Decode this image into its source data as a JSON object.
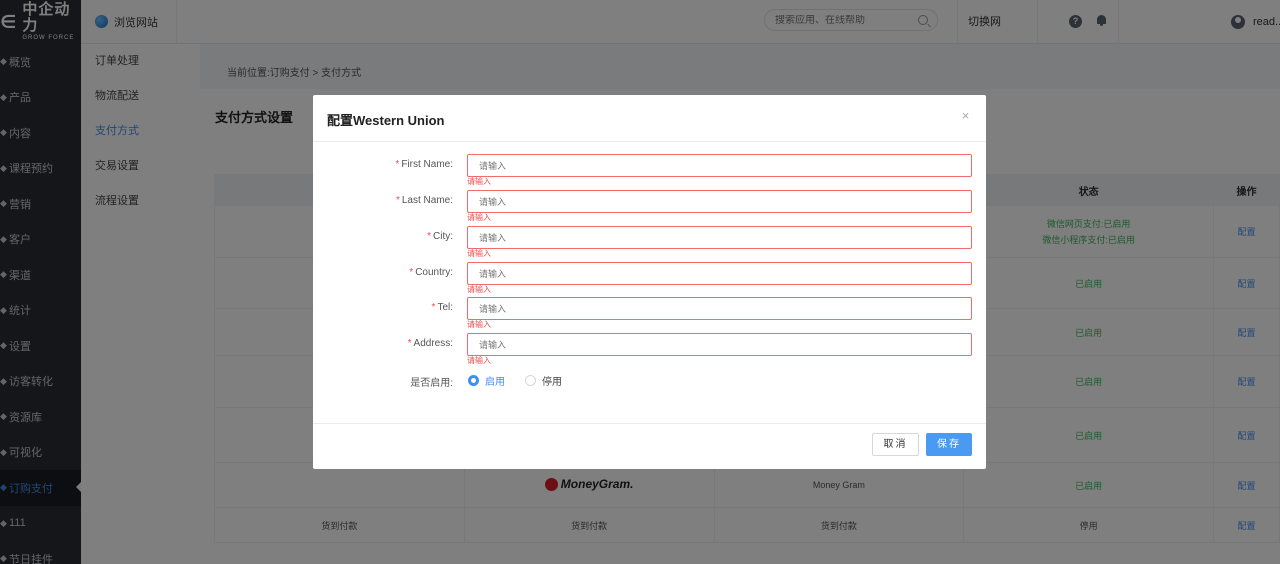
{
  "brand": {
    "logo_cn": "中企动力",
    "logo_en": "GROW FORCE"
  },
  "topbar": {
    "site_link": "浏览网站",
    "search_placeholder": "搜索应用、在线帮助",
    "switch_site": "切换网站",
    "user_name": "read..."
  },
  "sidebar": {
    "items": [
      {
        "label": "概览"
      },
      {
        "label": "产品"
      },
      {
        "label": "内容"
      },
      {
        "label": "课程预约"
      },
      {
        "label": "营销"
      },
      {
        "label": "客户"
      },
      {
        "label": "渠道"
      },
      {
        "label": "统计"
      },
      {
        "label": "设置"
      },
      {
        "label": "访客转化"
      },
      {
        "label": "资源库"
      },
      {
        "label": "可视化"
      },
      {
        "label": "订购支付"
      },
      {
        "label": "111"
      },
      {
        "label": "节日挂件"
      }
    ],
    "active_index": 12
  },
  "subnav": {
    "items": [
      {
        "label": "订单处理"
      },
      {
        "label": "物流配送"
      },
      {
        "label": "支付方式"
      },
      {
        "label": "交易设置"
      },
      {
        "label": "流程设置"
      }
    ],
    "active_index": 2
  },
  "breadcrumb": {
    "text": "当前位置:订购支付 > 支付方式"
  },
  "page": {
    "title": "支付方式设置"
  },
  "table": {
    "headers": [
      "",
      "",
      "",
      "状态",
      "操作"
    ],
    "rows": [
      {
        "c1": "",
        "c2": "",
        "c3": "",
        "status": [
          "微信网页支付:已启用",
          "微信小程序支付:已启用"
        ],
        "action": "配置"
      },
      {
        "c1": "",
        "c2": "",
        "c3": "",
        "status": [
          "已启用"
        ],
        "action": "配置"
      },
      {
        "c1": "",
        "c2": "",
        "c3": "",
        "status": [
          "已启用"
        ],
        "action": "配置"
      },
      {
        "c1": "",
        "c2": "",
        "c3": "",
        "status": [
          "已启用"
        ],
        "action": "配置"
      },
      {
        "c1": "",
        "c2": "",
        "c3": "",
        "status": [
          "已启用"
        ],
        "action": "配置"
      },
      {
        "c1": "",
        "c2": "MoneyGram.",
        "c3": "Money Gram",
        "status": [
          "已启用"
        ],
        "action": "配置"
      },
      {
        "c1": "货到付款",
        "c2": "货到付款",
        "c3": "货到付款",
        "status": [
          "停用"
        ],
        "action": "配置"
      }
    ]
  },
  "dialog": {
    "title": "配置Western Union",
    "close_symbol": "×",
    "fields": [
      {
        "label": "First Name:",
        "placeholder": "请输入",
        "error": "请输入"
      },
      {
        "label": "Last Name:",
        "placeholder": "请输入",
        "error": "请输入"
      },
      {
        "label": "City:",
        "placeholder": "请输入",
        "error": "请输入"
      },
      {
        "label": "Country:",
        "placeholder": "请输入",
        "error": "请输入"
      },
      {
        "label": "Tel:",
        "placeholder": "请输入",
        "error": "请输入"
      },
      {
        "label": "Address:",
        "placeholder": "请输入",
        "error": "请输入"
      }
    ],
    "required_mark": "*",
    "enable": {
      "label": "是否启用:",
      "options": [
        "启用",
        "停用"
      ],
      "selected": "启用"
    },
    "cancel_label": "取消",
    "save_label": "保存"
  },
  "colors": {
    "accent": "#3d8ff0",
    "error": "#f04b4b",
    "success": "#3bb35a",
    "sidebar_bg": "#2a2d33"
  }
}
